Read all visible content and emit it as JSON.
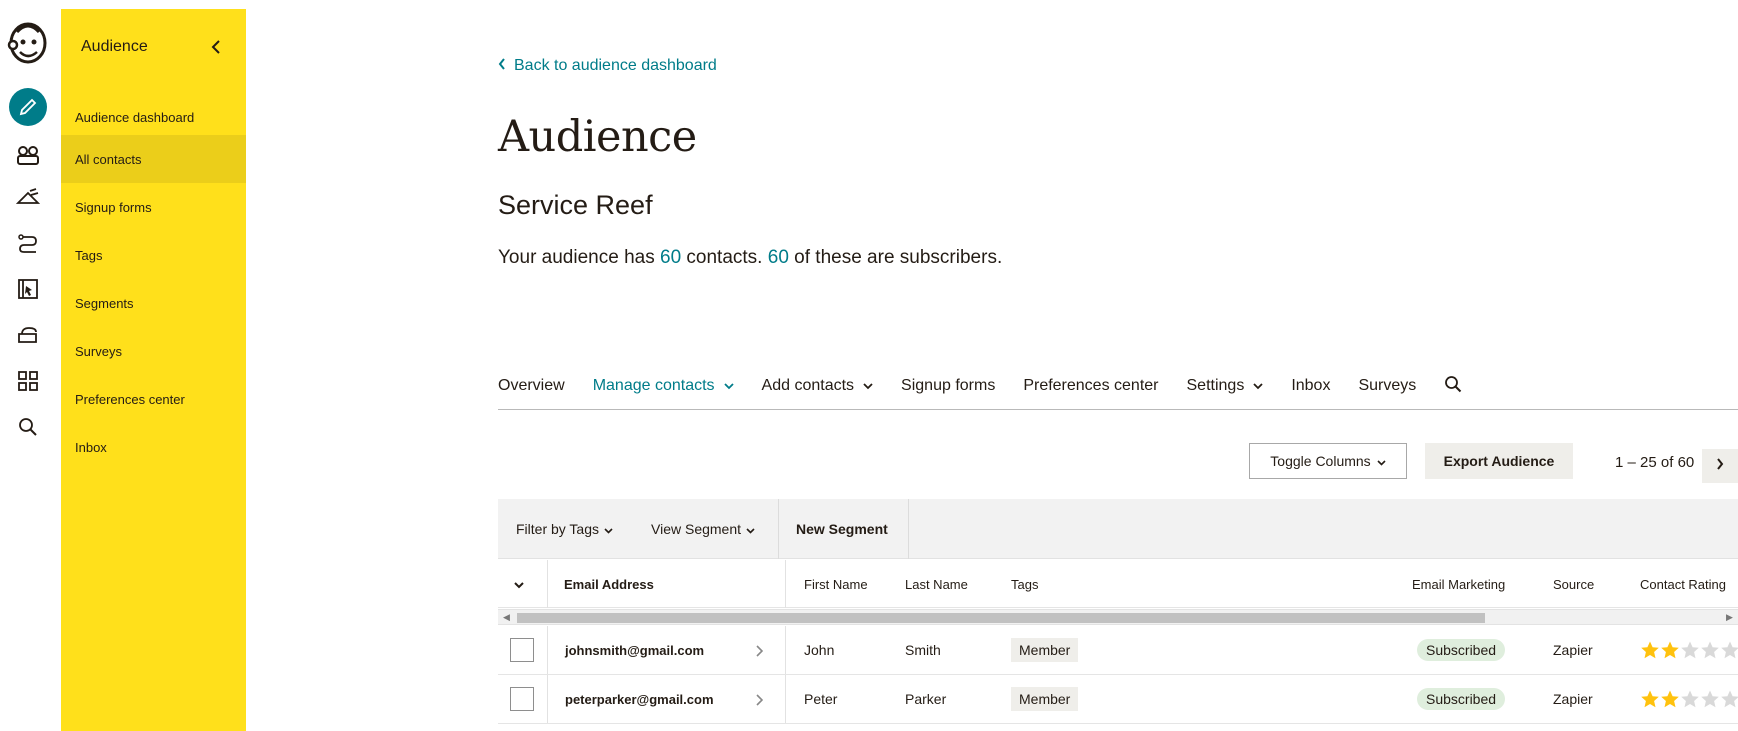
{
  "colors": {
    "accent": "#007c89",
    "sidebar": "#ffe01b",
    "sidebar_active": "#ebce1a",
    "star_on": "#ffc20e",
    "star_off": "#d9d9d9"
  },
  "rail": {
    "icons": [
      "mailchimp-logo",
      "create-icon",
      "audience-icon",
      "campaigns-icon",
      "automations-icon",
      "website-icon",
      "content-icon",
      "integrations-icon",
      "search-icon"
    ]
  },
  "sidebar": {
    "title": "Audience",
    "items": [
      {
        "label": "Audience dashboard",
        "active": false
      },
      {
        "label": "All contacts",
        "active": true
      },
      {
        "label": "Signup forms",
        "active": false
      },
      {
        "label": "Tags",
        "active": false
      },
      {
        "label": "Segments",
        "active": false
      },
      {
        "label": "Surveys",
        "active": false
      },
      {
        "label": "Preferences center",
        "active": false
      },
      {
        "label": "Inbox",
        "active": false
      }
    ]
  },
  "main": {
    "back_link": "Back to audience dashboard",
    "title": "Audience",
    "audience_name": "Service Reef",
    "summary": {
      "prefix": "Your audience has",
      "contacts": "60",
      "middle": "contacts.",
      "subscribers": "60",
      "suffix": "of these are subscribers."
    },
    "tabs": [
      {
        "label": "Overview",
        "active": false,
        "dropdown": false
      },
      {
        "label": "Manage contacts",
        "active": true,
        "dropdown": true
      },
      {
        "label": "Add contacts",
        "active": false,
        "dropdown": true
      },
      {
        "label": "Signup forms",
        "active": false,
        "dropdown": false
      },
      {
        "label": "Preferences center",
        "active": false,
        "dropdown": false
      },
      {
        "label": "Settings",
        "active": false,
        "dropdown": true
      },
      {
        "label": "Inbox",
        "active": false,
        "dropdown": false
      },
      {
        "label": "Surveys",
        "active": false,
        "dropdown": false
      }
    ],
    "toggle_columns": "Toggle Columns",
    "export_audience": "Export Audience",
    "pager": {
      "range": "1 – 25",
      "of": "of",
      "total": "60"
    },
    "filter_by_tags": "Filter by Tags",
    "view_segment": "View Segment",
    "new_segment": "New Segment",
    "columns": [
      "Email Address",
      "First Name",
      "Last Name",
      "Tags",
      "Email Marketing",
      "Source",
      "Contact Rating"
    ],
    "rows": [
      {
        "email": "johnsmith@gmail.com",
        "first": "John",
        "last": "Smith",
        "tag": "Member",
        "status": "Subscribed",
        "source": "Zapier",
        "rating": 2
      },
      {
        "email": "peterparker@gmail.com",
        "first": "Peter",
        "last": "Parker",
        "tag": "Member",
        "status": "Subscribed",
        "source": "Zapier",
        "rating": 2
      }
    ]
  }
}
